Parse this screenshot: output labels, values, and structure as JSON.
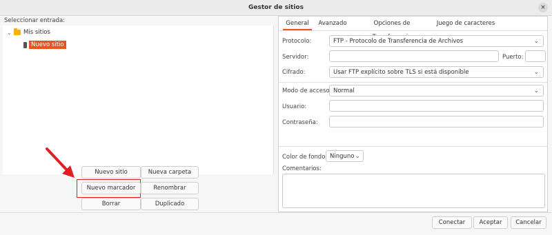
{
  "window": {
    "title": "Gestor de sitios",
    "close_icon": "×"
  },
  "left": {
    "select_label": "Seleccionar entrada:",
    "tree": {
      "root_label": "Mis sitios",
      "site_label": "Nuevo sitio"
    },
    "buttons": {
      "new_site": "Nuevo sitio",
      "new_folder": "Nueva carpeta",
      "new_bookmark": "Nuevo marcador",
      "rename": "Renombrar",
      "delete": "Borrar",
      "duplicate": "Duplicado"
    }
  },
  "tabs": [
    "General",
    "Avanzado",
    "Opciones de Transferencia",
    "Juego de caracteres"
  ],
  "general": {
    "protocol_label": "Protocolo:",
    "protocol_value": "FTP - Protocolo de Transferencia de Archivos",
    "server_label": "Servidor:",
    "server_value": "",
    "port_label": "Puerto:",
    "port_value": "",
    "encryption_label": "Cifrado:",
    "encryption_value": "Usar FTP explícito sobre TLS si está disponible",
    "access_label": "Modo de acceso:",
    "access_value": "Normal",
    "user_label": "Usuario:",
    "user_value": "",
    "password_label": "Contraseña:",
    "password_value": "",
    "bgcolor_label": "Color de fondo:",
    "bgcolor_value": "Ninguno",
    "comments_label": "Comentarios:"
  },
  "footer": {
    "connect": "Conectar",
    "accept": "Aceptar",
    "cancel": "Cancelar"
  },
  "colors": {
    "accent": "#e95420",
    "highlight": "#e02020"
  }
}
